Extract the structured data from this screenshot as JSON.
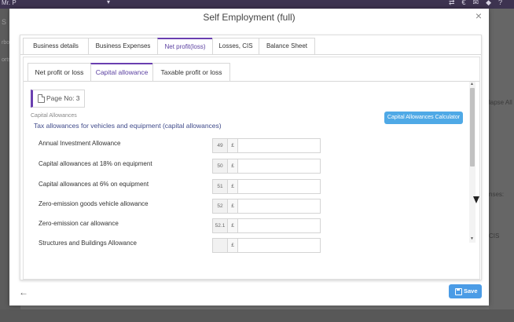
{
  "background": {
    "user_label": "Mr. P",
    "sidebar_fragments": [
      "S",
      "rboo",
      "orts"
    ],
    "right_fragments": [
      "lapse All",
      "CIS",
      "nses:"
    ],
    "top_icons": [
      "exchange-icon",
      "euro-icon",
      "megaphone-icon",
      "bell-icon",
      "help-icon"
    ]
  },
  "modal": {
    "title": "Self Employment (full)",
    "close_label": "×"
  },
  "main_tabs": [
    {
      "label": "Business details",
      "active": false
    },
    {
      "label": "Business Expenses",
      "active": false
    },
    {
      "label": "Net profit(loss)",
      "active": true
    },
    {
      "label": "Losses, CIS",
      "active": false
    },
    {
      "label": "Balance Sheet",
      "active": false
    }
  ],
  "sub_tabs": [
    {
      "label": "Net profit or loss",
      "active": false
    },
    {
      "label": "Capital allowance",
      "active": true
    },
    {
      "label": "Taxable profit or loss",
      "active": false
    }
  ],
  "page_label": "Page No: 3",
  "section_label": "Capital Allowances",
  "section_sub": "Tax allowances for vehicles and equipment (capital allowances)",
  "calc_button": "Capital Allowances Calculator",
  "rows": [
    {
      "label": "Annual Investment Allowance",
      "box": "49",
      "currency": "£",
      "value": ""
    },
    {
      "label": "Capital allowances at 18% on equipment",
      "box": "50",
      "currency": "£",
      "value": ""
    },
    {
      "label": "Capital allowances at 6% on equipment",
      "box": "51",
      "currency": "£",
      "value": ""
    },
    {
      "label": "Zero-emission goods vehicle allowance",
      "box": "52",
      "currency": "£",
      "value": ""
    },
    {
      "label": "Zero-emission car allowance",
      "box": "52.1",
      "currency": "£",
      "value": ""
    },
    {
      "label": "Structures and Buildings Allowance",
      "box": "",
      "currency": "£",
      "value": ""
    }
  ],
  "footer": {
    "back_icon": "←",
    "save_label": "Save"
  },
  "colors": {
    "accent": "#6a3fb0",
    "button_blue": "#4b9ce6"
  }
}
